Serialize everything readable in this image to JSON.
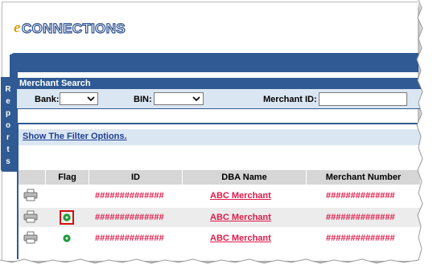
{
  "app": {
    "logo_e": "e",
    "logo_text": "CONNECTIONS"
  },
  "sidebar": {
    "reports_tab_letters": [
      "R",
      "e",
      "p",
      "o",
      "r",
      "t",
      "s"
    ]
  },
  "merchant_search": {
    "title": "Merchant Search",
    "bank_label": "Bank:",
    "bank_value": "",
    "bin_label": "BIN:",
    "bin_value": "",
    "merchant_id_label": "Merchant ID:",
    "merchant_id_value": ""
  },
  "results": {
    "filter_link": "Show The Filter Options.",
    "columns": [
      "",
      "Flag",
      "ID",
      "DBA Name",
      "Merchant Number"
    ],
    "rows": [
      {
        "flag": false,
        "id": "##############",
        "dba": "ABC Merchant",
        "merchant_number": "##############",
        "highlighted_flag": false
      },
      {
        "flag": true,
        "id": "##############",
        "dba": "ABC Merchant",
        "merchant_number": "##############",
        "highlighted_flag": true
      },
      {
        "flag": true,
        "id": "##############",
        "dba": "ABC Merchant",
        "merchant_number": "##############",
        "highlighted_flag": false
      }
    ]
  },
  "icons": {
    "printer": "printer-icon",
    "flag": "green-flag-icon",
    "dropdown": "chevron-down-icon"
  },
  "colors": {
    "brand_blue": "#2f5a93",
    "panel_light_blue": "#dbe6f3",
    "link_red": "#e01a4a",
    "flag_green": "#1e9a3a",
    "highlight_red": "#d01010"
  }
}
